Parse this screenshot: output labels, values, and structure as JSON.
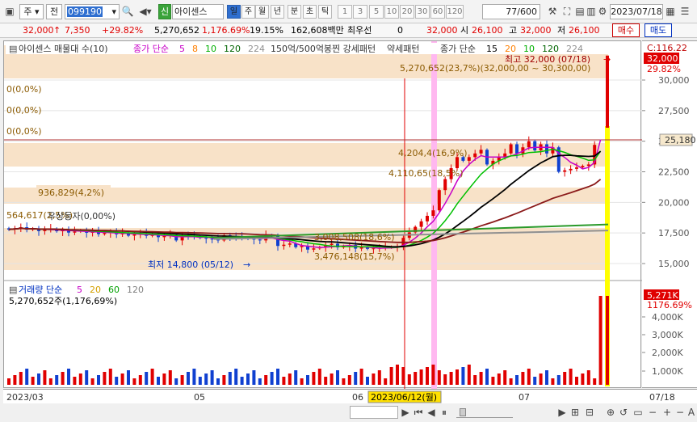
{
  "toolbar": {
    "type_sel": "주",
    "prev_label": "전",
    "code": "099190",
    "badge": "신",
    "stock_name": "아이센스",
    "periods": [
      "일",
      "주",
      "월",
      "년",
      "분",
      "초",
      "틱"
    ],
    "active_period": "일",
    "intervals": [
      "1",
      "3",
      "5",
      "10",
      "20",
      "30",
      "60",
      "120"
    ],
    "count": "77",
    "count_total": "/600",
    "date": "2023/07/18"
  },
  "quote": {
    "price": "32,000",
    "arrow": "↑",
    "change": "7,350",
    "change_pct": "+29.82%",
    "volume": "5,270,652",
    "volume_pct": "1,176.69%",
    "turnover": "19.15%",
    "amount": "162,608백만",
    "best_bid_label": "최우선",
    "best_bid_qty": "0",
    "best_bid": "32,000",
    "open_label": "시",
    "open": "26,100",
    "high_label": "고",
    "high": "32,000",
    "low_label": "저",
    "low": "26,100",
    "buy_label": "매수",
    "sell_label": "매도"
  },
  "legend": {
    "main_name": "아이센스 매물대 수(10)",
    "ma_label": "종가 단순",
    "ma_periods": [
      "5",
      "8",
      "10",
      "120",
      "224"
    ],
    "ma_colors": [
      "#c800c8",
      "#ff7f00",
      "#00b000",
      "#006400",
      "#909090"
    ],
    "pattern": "150억/500억봉찐 강세패턴",
    "weak": "약세패턴",
    "ma2_label": "종가 단순",
    "ma2_periods": [
      "15",
      "20",
      "10",
      "120",
      "224"
    ],
    "ma2_colors": [
      "#000000",
      "#ff7f00",
      "#00b000",
      "#006400",
      "#909090"
    ]
  },
  "annotations": {
    "high_note": "최고 32,000 (07/18)",
    "vol_top": "5,270,652(23,7%)(32,000,00 ~ 30,300,00)",
    "zero1": "0(0,0%)",
    "zero2": "0(0,0%)",
    "zero3": "0(0,0%)",
    "vp1": "4,204,4(16,9%)",
    "vp2": "4,110,65(18,5%)",
    "vp3": "936,829(4,2%)",
    "vp4": "564,617(2,5%)",
    "vp4b": "우상등자(0,00%)",
    "vp5": "3,476,148(15,7%)",
    "vp6": "3,008,508(18,6%)",
    "low_note": "최저 14,800 (05/12)",
    "vol_legend_name": "거래량 단순",
    "vol_ma": [
      "5",
      "20",
      "60",
      "120"
    ],
    "vol_ma_colors": [
      "#c800c8",
      "#d4a000",
      "#00a000",
      "#808080"
    ],
    "vol_value": "5,270,652주(1,176,69%)",
    "cursor_date": "2023/06/12(월)"
  },
  "right_axis": {
    "top_label": "C:116.22",
    "price_box": "32,000",
    "price_pct": "29.82%",
    "current_box": "25,180",
    "ticks": [
      "30,000",
      "27,500",
      "25,000",
      "22,500",
      "20,000",
      "17,500",
      "15,000"
    ],
    "vol_box": "5,271K",
    "vol_pct": "1176.69%",
    "vol_ticks": [
      "4,000K",
      "3,000K",
      "2,000K",
      "1,000K"
    ]
  },
  "x_axis": {
    "labels": [
      "2023/03",
      "05",
      "06",
      "07",
      "07/18"
    ]
  },
  "colors": {
    "up": "#e00000",
    "down": "#1040d0",
    "accent": "#2f6fd0",
    "highlight": "#ffff00"
  }
}
